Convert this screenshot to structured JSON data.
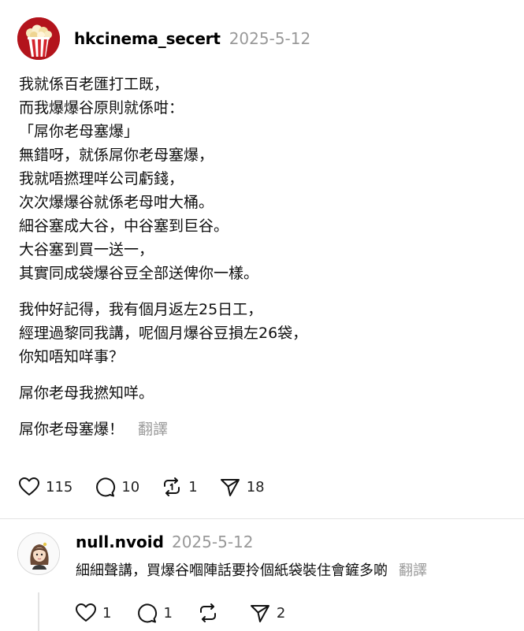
{
  "post": {
    "author": "hkcinema_secert",
    "date": "2025-5-12",
    "paragraphs": [
      [
        "我就係百老匯打工既，",
        "而我爆爆谷原則就係咁：",
        "「屌你老母塞爆」",
        "無錯呀，就係屌你老母塞爆，",
        "我就唔撚理咩公司虧錢，",
        "次次爆爆谷就係老母咁大桶。",
        "細谷塞成大谷，中谷塞到巨谷。",
        "大谷塞到買一送一，",
        "其實同成袋爆谷豆全部送俾你一樣。"
      ],
      [
        "我仲好記得，我有個月返左25日工，",
        "經理過黎同我講，呢個月￼爆谷豆損左26袋，",
        "你知唔知咩事？"
      ],
      [
        "屌你老母我撚知咩。"
      ]
    ],
    "last_line": "屌你老母塞爆！",
    "translate_label": "翻譯",
    "actions": {
      "like_count": "115",
      "comment_count": "10",
      "repost_count": "1",
      "share_count": "18"
    }
  },
  "reply": {
    "author": "null.nvoid",
    "date": "2025-5-12",
    "text": "細細聲講，買爆谷嗰陣話要拎個紙袋裝住會鏟多啲",
    "translate_label": "翻譯",
    "actions": {
      "like_count": "1",
      "comment_count": "1",
      "repost_count": "",
      "share_count": "2"
    }
  },
  "icons": {
    "avatar_main": "popcorn-bucket-icon",
    "avatar_reply": "cartoon-girl-avatar",
    "like": "heart-icon",
    "comment": "speech-bubble-icon",
    "repost": "repost-arrows-icon",
    "share": "paper-plane-icon"
  },
  "colors": {
    "muted_text": "#999999",
    "avatar_bg": "#b3141c",
    "divider": "#e3e3e3"
  }
}
